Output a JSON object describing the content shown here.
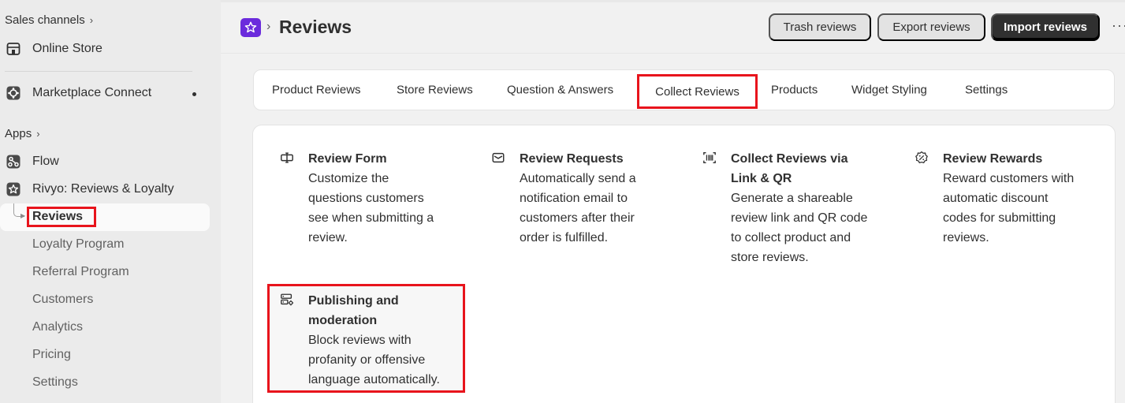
{
  "sidebar": {
    "sales_channels_label": "Sales channels",
    "online_store": "Online Store",
    "marketplace_connect": "Marketplace Connect",
    "apps_label": "Apps",
    "flow": "Flow",
    "rivyo": "Rivyo: Reviews & Loyalty",
    "sub_items": [
      "Reviews",
      "Loyalty Program",
      "Referral Program",
      "Customers",
      "Analytics",
      "Pricing",
      "Settings"
    ]
  },
  "header": {
    "title": "Reviews",
    "trash_label": "Trash reviews",
    "export_label": "Export reviews",
    "import_label": "Import reviews",
    "more_label": "···"
  },
  "tabs": [
    "Product Reviews",
    "Store Reviews",
    "Question & Answers",
    "Collect Reviews",
    "Products",
    "Widget Styling",
    "Settings"
  ],
  "active_tab": "Collect Reviews",
  "features": [
    {
      "icon": "review-form-icon",
      "title": "Review Form",
      "desc": [
        "Customize the",
        "questions customers",
        "see when submitting a",
        "review."
      ]
    },
    {
      "icon": "envelope-icon",
      "title": "Review Requests",
      "desc": [
        "Automatically send a",
        "notification email to",
        "customers after their",
        "order is fulfilled."
      ]
    },
    {
      "icon": "barcode-scan-icon",
      "title": "Collect Reviews via",
      "title2": "Link & QR",
      "desc": [
        "Generate a shareable",
        "review link and QR code",
        "to collect product and",
        "store reviews."
      ]
    },
    {
      "icon": "discount-badge-icon",
      "title": "Review Rewards",
      "desc": [
        "Reward customers with",
        "automatic discount",
        "codes for submitting",
        "reviews."
      ]
    },
    {
      "icon": "moderation-settings-icon",
      "title": "Publishing and",
      "title2": "moderation",
      "desc": [
        "Block reviews with",
        "profanity or offensive",
        "language automatically."
      ]
    }
  ],
  "colors": {
    "highlight": "#e8141c",
    "app_logo": "#6b2bdc",
    "primary_button": "#303030"
  }
}
